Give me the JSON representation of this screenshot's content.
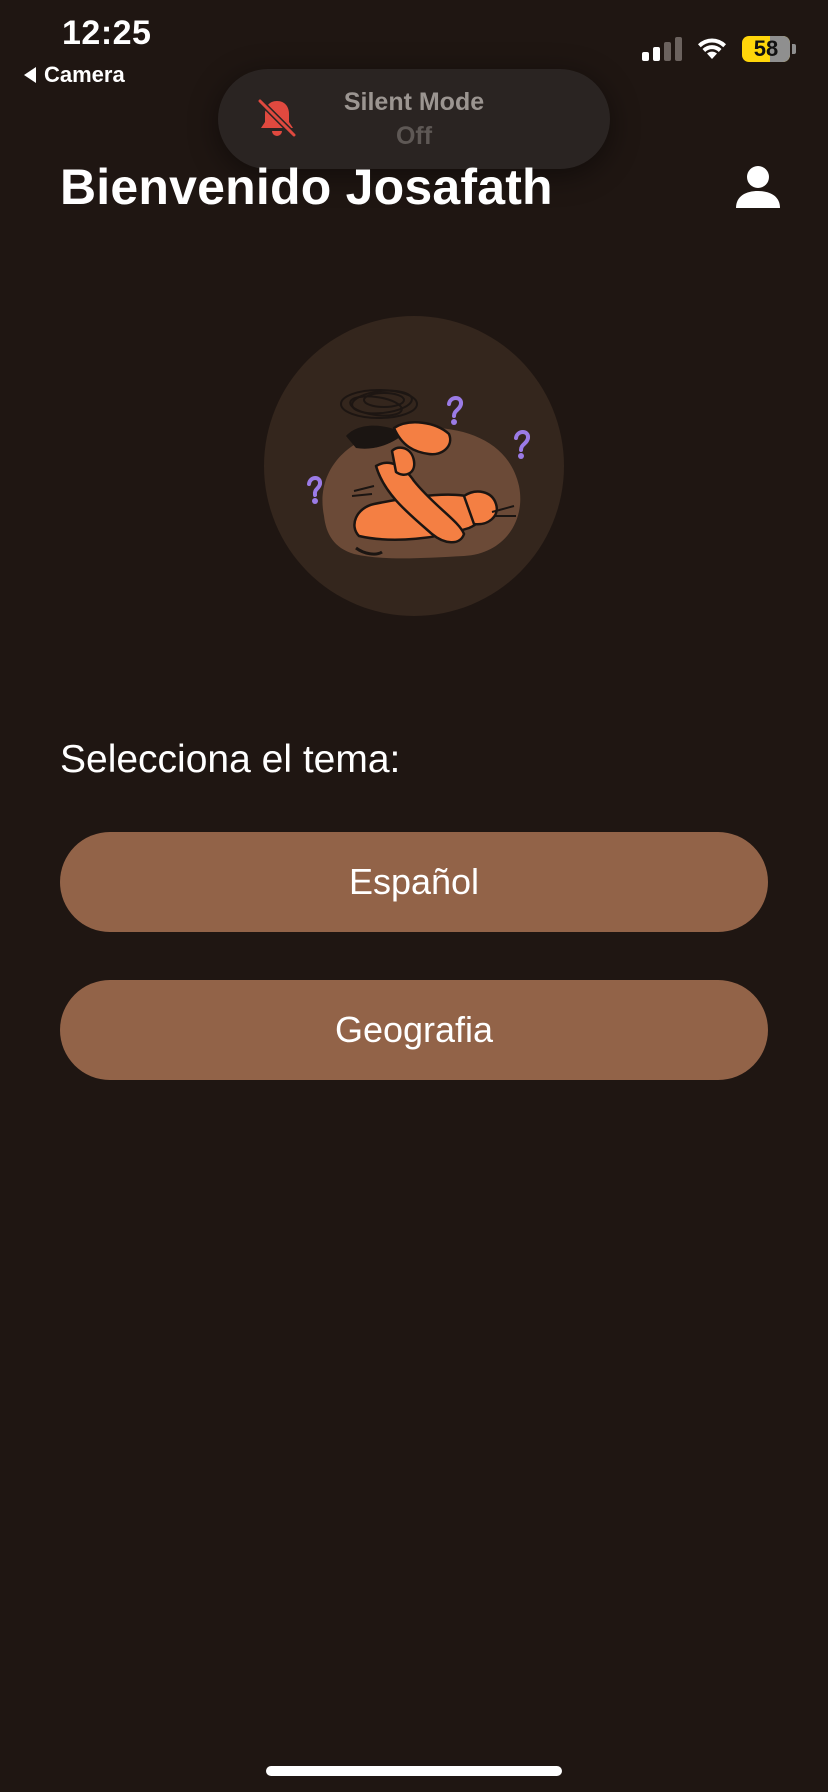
{
  "status_bar": {
    "time": "12:25",
    "back_label": "Camera",
    "battery_level": "58",
    "signal_bars_active": 2,
    "signal_bars_total": 4,
    "icons": [
      "cellular-signal-icon",
      "wifi-icon",
      "battery-icon"
    ]
  },
  "toast": {
    "title": "Silent Mode",
    "subtitle": "Off",
    "icon": "bell-slash-icon",
    "icon_color": "#e0493f"
  },
  "header": {
    "welcome": "Bienvenido Josafath",
    "profile_icon": "person-icon"
  },
  "illustration": {
    "subject": "confused-person-illustration",
    "question_mark_color": "#9b7be6",
    "figure_color": "#f47f43"
  },
  "topics": {
    "prompt": "Selecciona el tema:",
    "items": [
      {
        "label": "Español"
      },
      {
        "label": "Geografia"
      }
    ]
  },
  "colors": {
    "background": "#1f1612",
    "button": "#926348",
    "battery": "#ffd60a"
  }
}
